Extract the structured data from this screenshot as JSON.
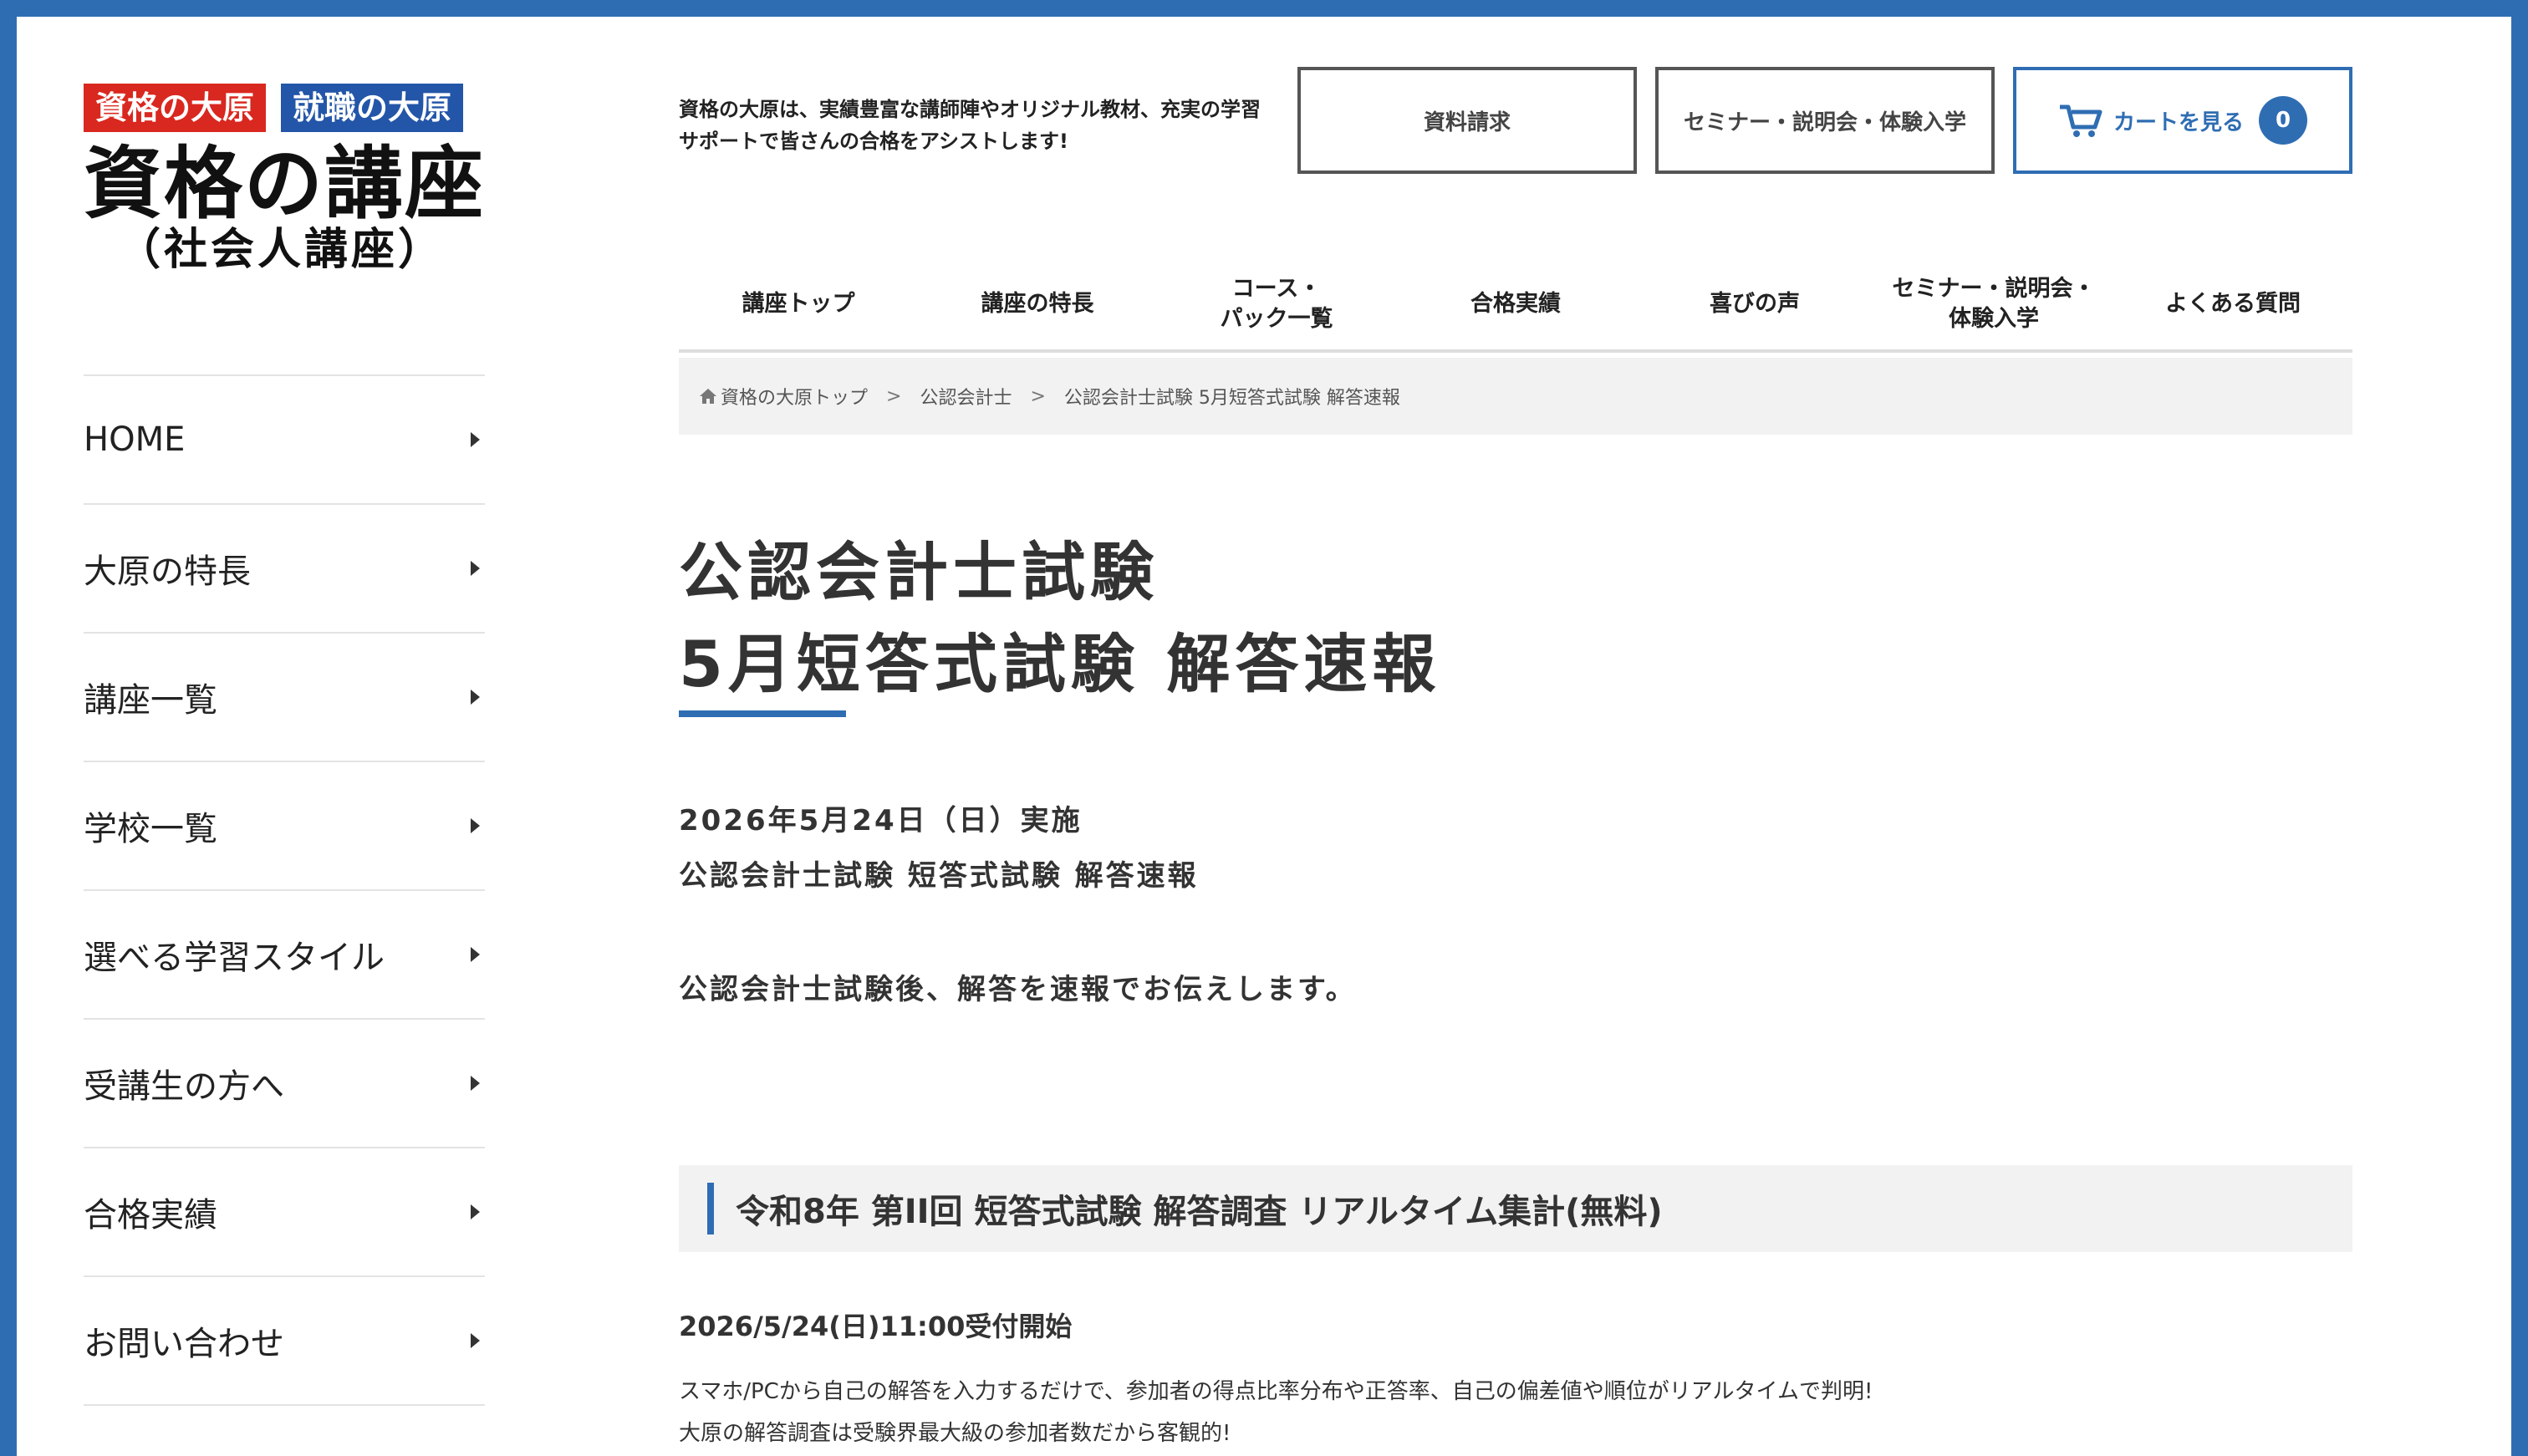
{
  "brand": {
    "badge_red": "資格の大原",
    "badge_blue": "就職の大原",
    "title": "資格の講座",
    "subtitle": "（社会人講座）"
  },
  "sidebar": {
    "items": [
      {
        "label": "HOME"
      },
      {
        "label": "大原の特長"
      },
      {
        "label": "講座一覧"
      },
      {
        "label": "学校一覧"
      },
      {
        "label": "選べる学習スタイル"
      },
      {
        "label": "受講生の方へ"
      },
      {
        "label": "合格実績"
      },
      {
        "label": "お問い合わせ"
      }
    ]
  },
  "header": {
    "tagline": "資格の大原は、実績豊富な講師陣やオリジナル教材、充実の学習サポートで皆さんの合格をアシストします!",
    "materials_label": "資料請求",
    "seminar_label": "セミナー・説明会・体験入学",
    "cart_label": "カートを見る",
    "cart_count": "0"
  },
  "topnav": {
    "items": [
      {
        "label": "講座トップ"
      },
      {
        "label": "講座の特長"
      },
      {
        "label": "コース・\nパック一覧"
      },
      {
        "label": "合格実績"
      },
      {
        "label": "喜びの声"
      },
      {
        "label": "セミナー・説明会・\n体験入学"
      },
      {
        "label": "よくある質問"
      }
    ]
  },
  "breadcrumb": {
    "home": "資格の大原トップ",
    "sep": ">",
    "level2": "公認会計士",
    "current": "公認会計士試験 5月短答式試験 解答速報"
  },
  "main": {
    "title_line1": "公認会計士試験",
    "title_line2": "5月短答式試験 解答速報",
    "date_line": "2026年5月24日（日）実施",
    "exam_line": "公認会計士試験 短答式試験 解答速報",
    "intro": "公認会計士試験後、解答を速報でお伝えします。"
  },
  "section": {
    "title": "令和8年 第II回 短答式試験 解答調査 リアルタイム集計(無料)",
    "start": "2026/5/24(日)11:00受付開始",
    "desc1": "スマホ/PCから自己の解答を入力するだけで、参加者の得点比率分布や正答率、自己の偏差値や順位がリアルタイムで判明!",
    "desc2": "大原の解答調査は受験界最大級の参加者数だから客観的!"
  },
  "colors": {
    "accent": "#2f6db3",
    "badge_red": "#d9281f",
    "badge_blue": "#2356a8"
  }
}
